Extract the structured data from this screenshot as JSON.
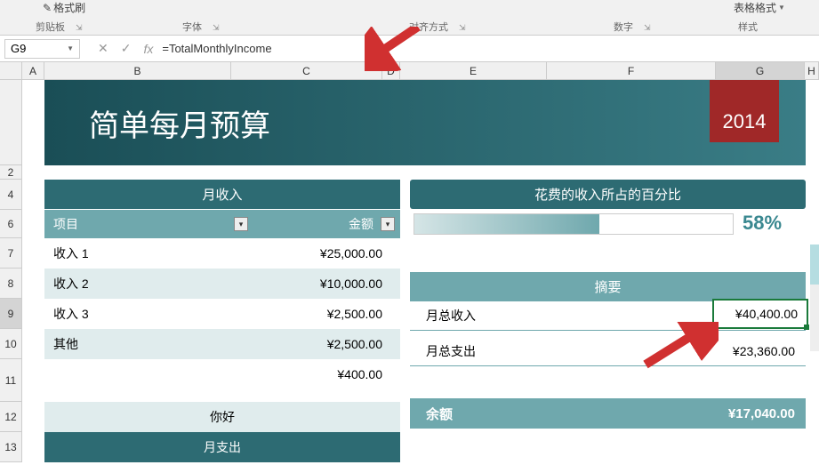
{
  "ribbon": {
    "format_brush": "格式刷",
    "table_format": "表格格式",
    "group_clipboard": "剪贴板",
    "group_font": "字体",
    "group_alignment": "对齐方式",
    "group_number": "数字",
    "group_styles": "样式"
  },
  "formula_bar": {
    "cell_ref": "G9",
    "formula": "=TotalMonthlyIncome"
  },
  "columns": {
    "a": "A",
    "b": "B",
    "c": "C",
    "d": "D",
    "e": "E",
    "f": "F",
    "g": "G",
    "h": "H"
  },
  "rows": {
    "r2": "2",
    "r4": "4",
    "r6": "6",
    "r7": "7",
    "r8": "8",
    "r9": "9",
    "r10": "10",
    "r11": "11",
    "r12": "12",
    "r13": "13"
  },
  "banner": {
    "title": "简单每月预算",
    "year": "2014"
  },
  "income": {
    "header": "月收入",
    "col_item": "项目",
    "col_amount": "金额",
    "rows": [
      {
        "item": "收入 1",
        "amount": "¥25,000.00"
      },
      {
        "item": "收入 2",
        "amount": "¥10,000.00"
      },
      {
        "item": "收入 3",
        "amount": "¥2,500.00"
      },
      {
        "item": "其他",
        "amount": "¥2,500.00"
      },
      {
        "item": "",
        "amount": "¥400.00"
      }
    ],
    "hello": "你好"
  },
  "expense": {
    "header": "月支出"
  },
  "percentage": {
    "header": "花费的收入所占的百分比",
    "value": "58%"
  },
  "summary": {
    "header": "摘要",
    "total_income_label": "月总收入",
    "total_income_value": "¥40,400.00",
    "total_expense_label": "月总支出",
    "total_expense_value": "¥23,360.00",
    "balance_label": "余额",
    "balance_value": "¥17,040.00"
  }
}
